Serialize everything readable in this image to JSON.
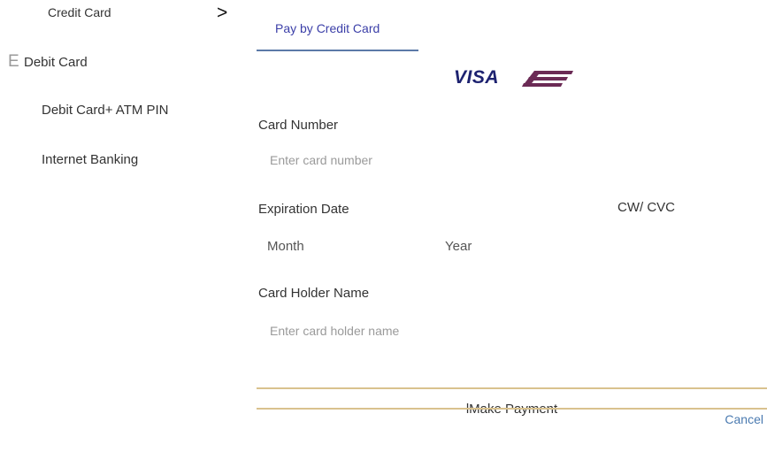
{
  "payment_methods": {
    "credit_card": "Credit Card",
    "chevron": ">",
    "debit_card_icon_glyph": "E",
    "debit_card": "Debit Card",
    "debit_card_atm_pin": "Debit Card+ ATM PIN",
    "internet_banking": "Internet Banking"
  },
  "form": {
    "tab_label": "Pay by Credit Card",
    "brand_logo_text": "VISA",
    "brand_icon": "card-brand-stripes-icon",
    "card_number_label": "Card Number",
    "card_number_placeholder": "Enter card number",
    "expiration_label": "Expiration Date",
    "month_placeholder": "Month",
    "year_placeholder": "Year",
    "cvv_label": "CW/ CVC",
    "holder_label": "Card Holder Name",
    "holder_placeholder": "Enter card holder name",
    "submit_label": "lMake Payment",
    "cancel_label": "Cancel"
  },
  "colors": {
    "tab_text": "#3b3fa8",
    "tab_underline": "#5b7aa8",
    "visa_blue": "#1d2270",
    "brand_maroon": "#6b2a55",
    "pay_rule": "#d9c28e",
    "cancel_link": "#4a7ab0"
  }
}
